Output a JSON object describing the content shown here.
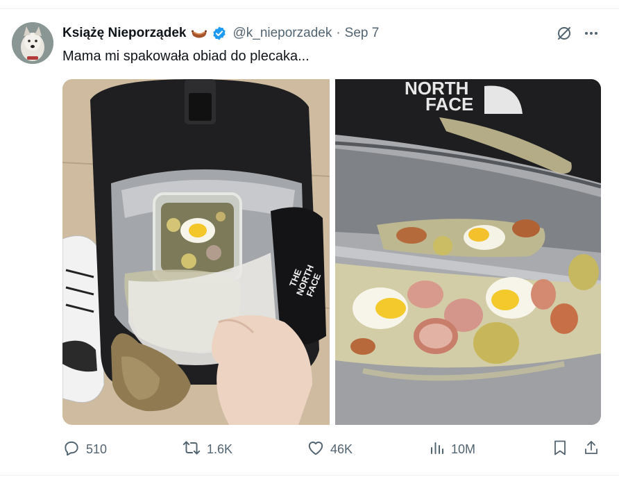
{
  "tweet": {
    "display_name": "Książę Nieporządek",
    "handle": "@k_nieporzadek",
    "separator": "·",
    "date": "Sep 7",
    "text": "Mama mi spakowała obiad do plecaka...",
    "verified_color": "#1d9bf0",
    "icons": [
      "sausage-emoji-icon",
      "verified-badge-icon",
      "grok-icon",
      "more-icon"
    ]
  },
  "left_photo": {
    "brand_text": [
      "THE",
      "NORTH",
      "FACE"
    ]
  },
  "right_photo": {
    "brand_text": [
      "NORTH",
      "FACE"
    ]
  },
  "actions": {
    "replies": "510",
    "reposts": "1.6K",
    "likes": "46K",
    "views": "10M",
    "icons": [
      "reply-icon",
      "repost-icon",
      "like-icon",
      "views-icon",
      "bookmark-icon",
      "share-icon"
    ]
  },
  "colors": {
    "text": "#0f1419",
    "secondary": "#536471",
    "accent": "#1d9bf0"
  }
}
